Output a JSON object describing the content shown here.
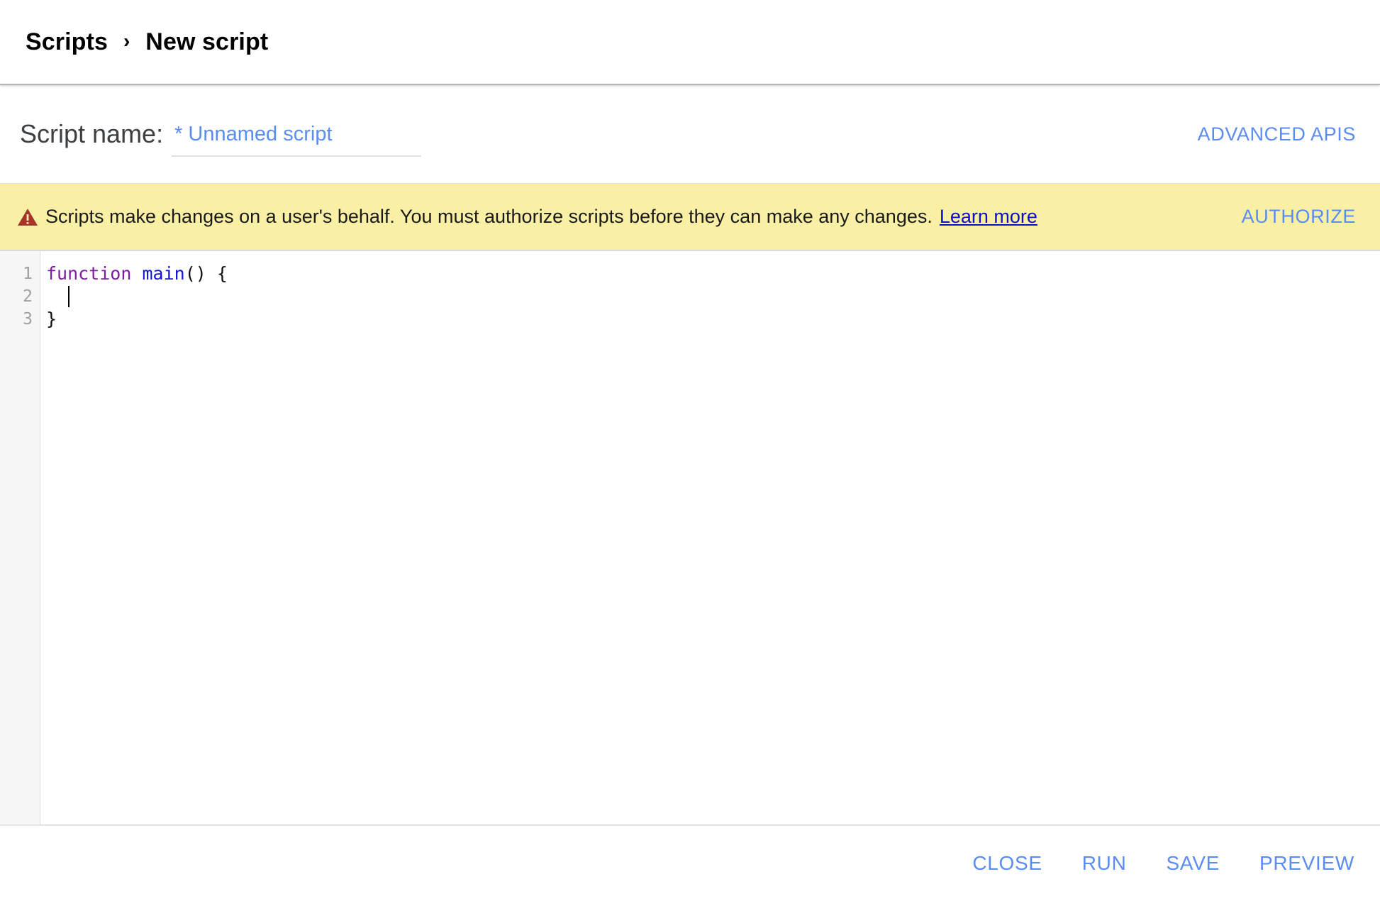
{
  "breadcrumb": {
    "root_label": "Scripts",
    "separator": "›",
    "current_label": "New script"
  },
  "script_name_row": {
    "label": "Script name:",
    "value": "* Unnamed script",
    "placeholder": "Unnamed script",
    "advanced_apis_label": "ADVANCED APIS"
  },
  "warning_banner": {
    "icon": "warning-triangle-icon",
    "message": "Scripts make changes on a user's behalf. You must authorize scripts before they can make any changes.",
    "learn_more_label": "Learn more",
    "authorize_label": "AUTHORIZE",
    "background_color": "#faf0a5",
    "icon_color": "#a5342b"
  },
  "editor": {
    "line_numbers": [
      "1",
      "2",
      "3"
    ],
    "lines": [
      {
        "tokens": [
          {
            "text": "function",
            "type": "keyword"
          },
          {
            "text": " ",
            "type": "plain"
          },
          {
            "text": "main",
            "type": "function"
          },
          {
            "text": "() {",
            "type": "plain"
          }
        ]
      },
      {
        "tokens": [
          {
            "text": "  ",
            "type": "plain"
          }
        ],
        "caret": true
      },
      {
        "tokens": [
          {
            "text": "}",
            "type": "plain"
          }
        ]
      }
    ],
    "plain_text": "function main() {\n  \n}",
    "keyword_color": "#7d1fa0",
    "function_color": "#1414d6",
    "gutter_color": "#f6f6f6"
  },
  "footer": {
    "buttons": [
      {
        "label": "CLOSE",
        "name": "close-button"
      },
      {
        "label": "RUN",
        "name": "run-button"
      },
      {
        "label": "SAVE",
        "name": "save-button"
      },
      {
        "label": "PREVIEW",
        "name": "preview-button"
      }
    ],
    "accent_color": "#5b8cf0"
  }
}
